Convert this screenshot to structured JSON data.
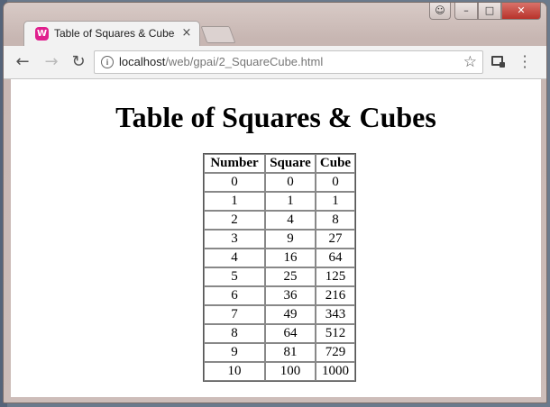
{
  "browser": {
    "tab_title": "Table of Squares & Cubes",
    "tab_favicon": "wamp-icon",
    "tab_close": "×",
    "url_host": "localhost",
    "url_path": "/web/gpai/2_SquareCube.html",
    "star_glyph": "☆",
    "back_glyph": "←",
    "forward_glyph": "→",
    "reload_glyph": "↻",
    "menu_glyph": "⋮",
    "info_glyph": "i",
    "win_min": "–",
    "win_max": "□",
    "win_close": "✕",
    "win_user": "👤"
  },
  "page": {
    "title": "Table of Squares & Cubes",
    "table": {
      "headers": [
        "Number",
        "Square",
        "Cube"
      ],
      "rows": [
        [
          "0",
          "0",
          "0"
        ],
        [
          "1",
          "1",
          "1"
        ],
        [
          "2",
          "4",
          "8"
        ],
        [
          "3",
          "9",
          "27"
        ],
        [
          "4",
          "16",
          "64"
        ],
        [
          "5",
          "25",
          "125"
        ],
        [
          "6",
          "36",
          "216"
        ],
        [
          "7",
          "49",
          "343"
        ],
        [
          "8",
          "64",
          "512"
        ],
        [
          "9",
          "81",
          "729"
        ],
        [
          "10",
          "100",
          "1000"
        ]
      ]
    }
  },
  "colors": {
    "favicon": "#e0208e",
    "close_button": "#c8433a"
  }
}
